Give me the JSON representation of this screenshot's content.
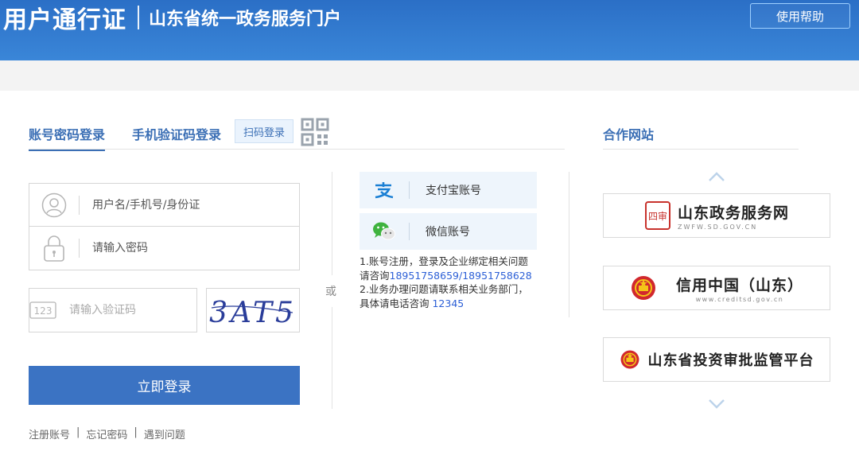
{
  "header": {
    "brand_main": "用户通行证",
    "brand_sub": "山东省统一政务服务门户",
    "help_label": "使用帮助"
  },
  "login": {
    "tabs": {
      "account": "账号密码登录",
      "sms": "手机验证码登录",
      "scan": "扫码登录"
    },
    "username_placeholder": "用户名/手机号/身份证",
    "password_placeholder": "请输入密码",
    "captcha_placeholder": "请输入验证码",
    "captcha_icon_text": "123",
    "captcha_text": "3AT5",
    "login_button": "立即登录",
    "links": {
      "register": "注册账号",
      "forgot": "忘记密码",
      "problem": "遇到问题",
      "sep": "|"
    }
  },
  "alt": {
    "or": "或",
    "alipay": "支付宝账号",
    "wechat": "微信账号",
    "notes": {
      "line1": "1.账号注册，登录及企业绑定相关问题",
      "line2_prefix": "请咨询",
      "line2_phone": "18951758659/18951758628",
      "line3": "2.业务办理问题请联系相关业务部门，",
      "line4_prefix": "具体请电话咨询 ",
      "line4_phone": "12345"
    }
  },
  "partners": {
    "title": "合作网站",
    "items": [
      {
        "name": "山东政务服务网",
        "url": "ZWFW.SD.GOV.CN",
        "seal": "四审"
      },
      {
        "name": "信用中国（山东）",
        "url": "www.creditsd.gov.cn"
      },
      {
        "name": "山东省投资审批监管平台"
      }
    ]
  },
  "colors": {
    "header": "#2b6fc6",
    "accent": "#3b6fb5",
    "button": "#3b73c3",
    "phone": "#2c5fd6"
  }
}
